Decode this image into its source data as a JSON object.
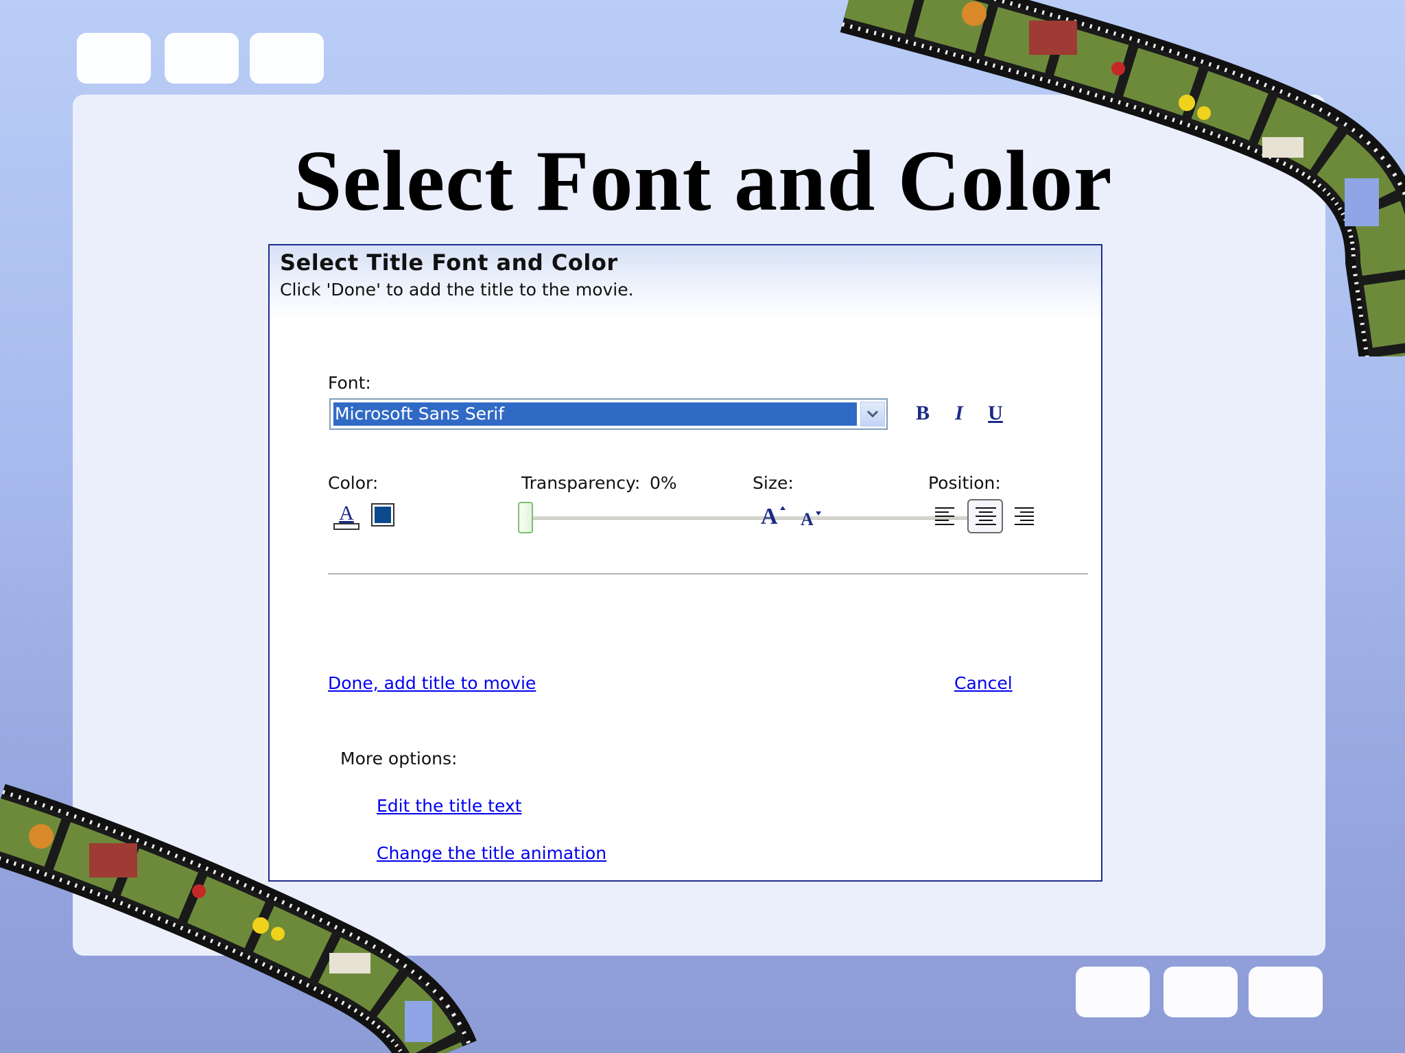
{
  "slide": {
    "title": "Select Font and Color"
  },
  "dialog": {
    "heading": "Select Title Font and Color",
    "subheading": "Click 'Done' to add the title to the movie.",
    "font": {
      "label": "Font:",
      "selected": "Microsoft Sans Serif"
    },
    "style_buttons": {
      "bold": "B",
      "italic": "I",
      "underline": "U"
    },
    "color": {
      "label": "Color:",
      "swatch": "#0b4a8c"
    },
    "transparency": {
      "label": "Transparency:",
      "value_text": "0%",
      "value": 0
    },
    "size": {
      "label": "Size:"
    },
    "position": {
      "label": "Position:",
      "selected": "center"
    },
    "actions": {
      "done": "Done, add title to movie",
      "cancel": "Cancel"
    },
    "more_options": {
      "label": "More options:",
      "edit_text": "Edit the title text",
      "change_animation": "Change the title animation"
    }
  },
  "colors": {
    "link": "#0000ee",
    "selection": "#316ac5",
    "dialog_border": "#1c2c8c"
  }
}
